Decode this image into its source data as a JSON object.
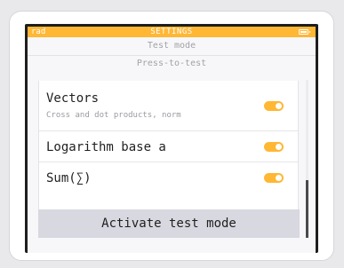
{
  "statusbar": {
    "left": "rad",
    "title": "SETTINGS",
    "battery_icon": "battery-icon"
  },
  "header": {
    "line1": "Test mode",
    "line2": "Press-to-test"
  },
  "items": [
    {
      "label": "Vectors",
      "sublabel": "Cross and dot products, norm",
      "enabled": true
    },
    {
      "label": "Logarithm base a",
      "enabled": true
    },
    {
      "label": "Sum(∑)",
      "enabled": true
    }
  ],
  "activate_button": {
    "label": "Activate test mode"
  },
  "colors": {
    "accent": "#ffb734",
    "button_bg": "#d8d8e0",
    "screen_bg": "#f7f7f9"
  }
}
